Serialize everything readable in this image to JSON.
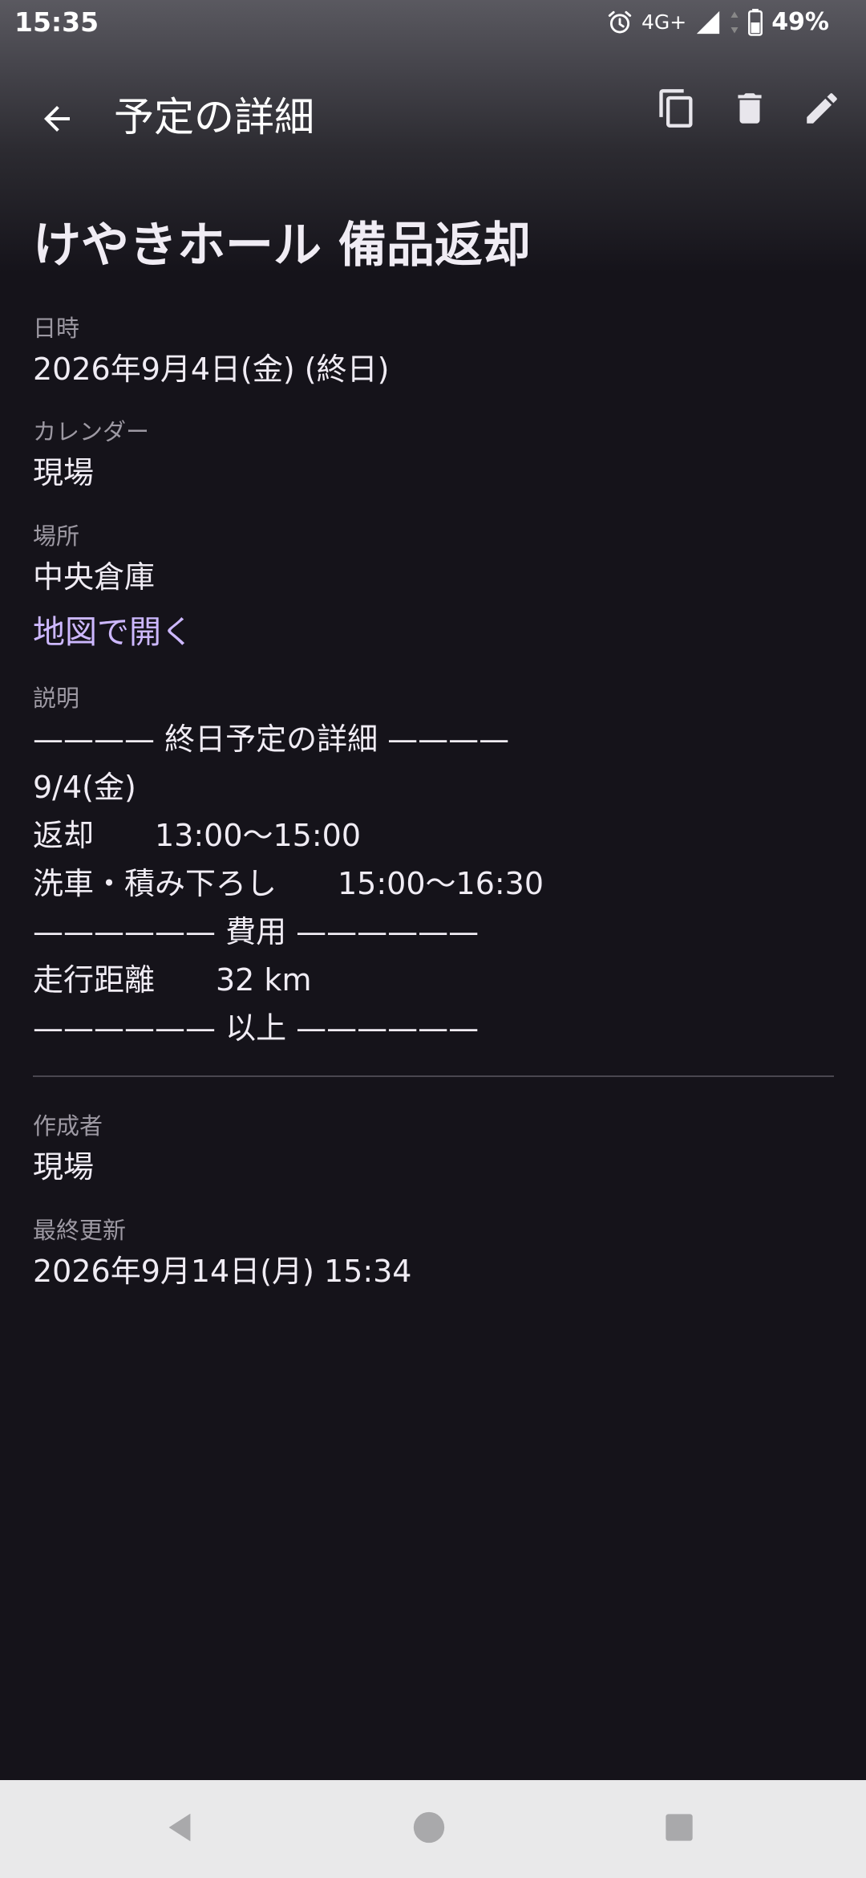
{
  "status_bar": {
    "time": "15:35",
    "network": "4G+",
    "battery": "49%",
    "icons": [
      "alarm-icon",
      "signal-icon",
      "battery-icon"
    ]
  },
  "app_bar": {
    "title": "予定の詳細",
    "icons": [
      "back-arrow-icon",
      "copy-icon",
      "delete-icon",
      "edit-icon"
    ]
  },
  "event": {
    "title": "けやきホール 備品返却",
    "datetime_label": "日時",
    "datetime_value": "2026年9月4日(金) (終日)",
    "calendar_label": "カレンダー",
    "calendar_value": "現場",
    "location_label": "場所",
    "location_value": "中央倉庫",
    "map_link": "地図で開く",
    "description_label": "説明",
    "description_lines": [
      "———— 終日予定の詳細 ————",
      "9/4(金)",
      "返却　　13:00〜15:00",
      "洗車・積み下ろし　　15:00〜16:30",
      "—————— 費用 ——————",
      "走行距離　　32 km",
      "—————— 以上 ——————"
    ],
    "creator_label": "作成者",
    "creator_value": "現場",
    "updated_label": "最終更新",
    "updated_value": "2026年9月14日(月) 15:34"
  },
  "nav_bar": {
    "icons": [
      "nav-back-icon",
      "nav-home-icon",
      "nav-recents-icon"
    ]
  },
  "colors": {
    "background": "#15131a",
    "link": "#cdb8ff",
    "label": "#9d99a3",
    "text": "#f0ecf4"
  }
}
